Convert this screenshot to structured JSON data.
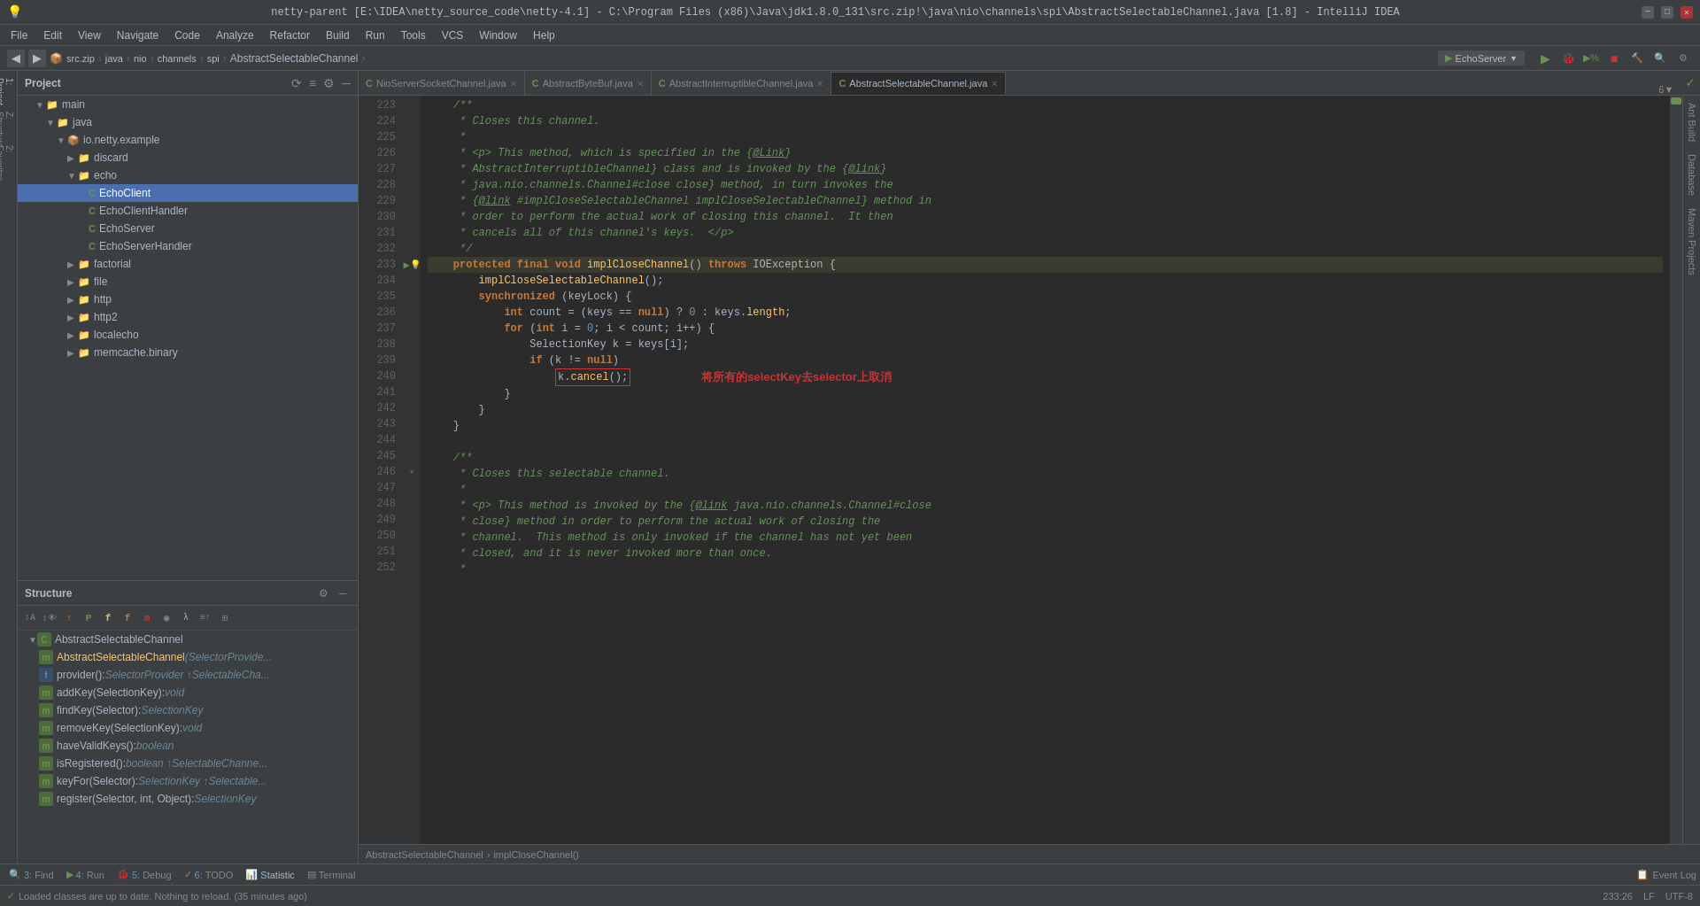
{
  "titlebar": {
    "title": "netty-parent [E:\\IDEA\\netty_source_code\\netty-4.1] - C:\\Program Files (x86)\\Java\\jdk1.8.0_131\\src.zip!\\java\\nio\\channels\\spi\\AbstractSelectableChannel.java [1.8] - IntelliJ IDEA"
  },
  "menubar": {
    "items": [
      "File",
      "Edit",
      "View",
      "Navigate",
      "Code",
      "Analyze",
      "Refactor",
      "Build",
      "Run",
      "Tools",
      "VCS",
      "Window",
      "Help"
    ]
  },
  "breadcrumb": {
    "path": [
      "src.zip",
      "java",
      "nio",
      "channels",
      "spi",
      "AbstractSelectableChannel"
    ],
    "run_config": "EchoServer"
  },
  "project_panel": {
    "title": "Project",
    "tree": [
      {
        "indent": 2,
        "type": "folder",
        "label": "main",
        "expanded": true
      },
      {
        "indent": 3,
        "type": "folder",
        "label": "java",
        "expanded": true
      },
      {
        "indent": 4,
        "type": "folder",
        "label": "io.netty.example",
        "expanded": true
      },
      {
        "indent": 5,
        "type": "folder",
        "label": "discard",
        "expanded": false
      },
      {
        "indent": 5,
        "type": "folder",
        "label": "echo",
        "expanded": true
      },
      {
        "indent": 6,
        "type": "java_c",
        "label": "EchoClient",
        "selected": true
      },
      {
        "indent": 6,
        "type": "java_c",
        "label": "EchoClientHandler"
      },
      {
        "indent": 6,
        "type": "java_c",
        "label": "EchoServer"
      },
      {
        "indent": 6,
        "type": "java_c",
        "label": "EchoServerHandler"
      },
      {
        "indent": 5,
        "type": "folder",
        "label": "factorial",
        "expanded": false
      },
      {
        "indent": 5,
        "type": "folder",
        "label": "file",
        "expanded": false
      },
      {
        "indent": 5,
        "type": "folder",
        "label": "http",
        "expanded": false
      },
      {
        "indent": 5,
        "type": "folder",
        "label": "http2",
        "expanded": false
      },
      {
        "indent": 5,
        "type": "folder",
        "label": "localecho",
        "expanded": false
      },
      {
        "indent": 5,
        "type": "folder",
        "label": "memcache.binary",
        "expanded": false
      }
    ]
  },
  "structure_panel": {
    "title": "Structure",
    "class_name": "AbstractSelectableChannel",
    "items": [
      {
        "type": "constructor",
        "label": "AbstractSelectableChannel(SelectorProvide..."
      },
      {
        "type": "field",
        "label": "provider(): SelectorProvider ↑SelectableCha..."
      },
      {
        "type": "method",
        "label": "addKey(SelectionKey): void"
      },
      {
        "type": "method",
        "label": "findKey(Selector): SelectionKey"
      },
      {
        "type": "method",
        "label": "removeKey(SelectionKey): void"
      },
      {
        "type": "method",
        "label": "haveValidKeys(): boolean"
      },
      {
        "type": "method",
        "label": "isRegistered(): boolean ↑SelectableChanne..."
      },
      {
        "type": "method",
        "label": "keyFor(Selector): SelectionKey ↑Selectable..."
      },
      {
        "type": "method",
        "label": "register(Selector, int, Object): SelectionKey"
      }
    ]
  },
  "tabs": [
    {
      "label": "NioServerSocketChannel.java",
      "type": "C",
      "active": false
    },
    {
      "label": "AbstractByteBuf.java",
      "type": "C",
      "active": false
    },
    {
      "label": "AbstractInterruptibleChannel.java",
      "type": "C",
      "active": false
    },
    {
      "label": "AbstractSelectableChannel.java",
      "type": "C",
      "active": true
    }
  ],
  "tab_count": "6",
  "code": {
    "lines": [
      {
        "num": 223,
        "content": "    /**",
        "type": "comment"
      },
      {
        "num": 224,
        "content": "     * Closes this channel.",
        "type": "comment"
      },
      {
        "num": 225,
        "content": "     *",
        "type": "comment"
      },
      {
        "num": 226,
        "content": "     * <p> This method, which is specified in the {@link",
        "type": "comment"
      },
      {
        "num": 227,
        "content": "     * AbstractInterruptibleChannel} class and is invoked by the {@link",
        "type": "comment"
      },
      {
        "num": 228,
        "content": "     * java.nio.channels.Channel#close close} method, in turn invokes the",
        "type": "comment"
      },
      {
        "num": 229,
        "content": "     * {@link #implCloseSelectableChannel implCloseSelectableChannel} method in",
        "type": "comment"
      },
      {
        "num": 230,
        "content": "     * order to perform the actual work of closing this channel.  It then",
        "type": "comment"
      },
      {
        "num": 231,
        "content": "     * cancels all of this channel's keys.  </p>",
        "type": "comment"
      },
      {
        "num": 232,
        "content": "     */",
        "type": "comment"
      },
      {
        "num": 233,
        "content": "    protected final void implCloseChannel() throws IOException {",
        "type": "code",
        "highlighted": true
      },
      {
        "num": 234,
        "content": "        implCloseSelectableChannel();",
        "type": "code"
      },
      {
        "num": 235,
        "content": "        synchronized (keyLock) {",
        "type": "code"
      },
      {
        "num": 236,
        "content": "            int count = (keys == null) ? 0 : keys.length;",
        "type": "code"
      },
      {
        "num": 237,
        "content": "            for (int i = 0; i < count; i++) {",
        "type": "code"
      },
      {
        "num": 238,
        "content": "                SelectionKey k = keys[i];",
        "type": "code"
      },
      {
        "num": 239,
        "content": "                if (k != null)",
        "type": "code"
      },
      {
        "num": 240,
        "content": "                    k.cancel();",
        "type": "code",
        "has_box": true
      },
      {
        "num": 241,
        "content": "            }",
        "type": "code"
      },
      {
        "num": 242,
        "content": "        }",
        "type": "code"
      },
      {
        "num": 243,
        "content": "    }",
        "type": "code"
      },
      {
        "num": 244,
        "content": "",
        "type": "empty"
      },
      {
        "num": 245,
        "content": "    /**",
        "type": "comment"
      },
      {
        "num": 246,
        "content": "     * Closes this selectable channel.",
        "type": "comment"
      },
      {
        "num": 247,
        "content": "     *",
        "type": "comment"
      },
      {
        "num": 248,
        "content": "     * <p> This method is invoked by the {@link java.nio.channels.Channel#close",
        "type": "comment"
      },
      {
        "num": 249,
        "content": "     * close} method in order to perform the actual work of closing the",
        "type": "comment"
      },
      {
        "num": 250,
        "content": "     * channel.  This method is only invoked if the channel has not yet been",
        "type": "comment"
      },
      {
        "num": 251,
        "content": "     * closed, and it is never invoked more than once.",
        "type": "comment"
      },
      {
        "num": 252,
        "content": "     *",
        "type": "comment"
      }
    ],
    "annotation": "将所有的selectKey去selector上取消"
  },
  "code_breadcrumb": {
    "path": [
      "AbstractSelectableChannel",
      "implCloseChannel()"
    ]
  },
  "bottom_toolbar": {
    "buttons": [
      {
        "num": "3",
        "label": "Find"
      },
      {
        "num": "4",
        "label": "Run"
      },
      {
        "num": "5",
        "label": "Debug"
      },
      {
        "num": "6",
        "label": "TODO"
      },
      {
        "label": "Statistic"
      },
      {
        "label": "Terminal"
      }
    ],
    "event_log": "Event Log"
  },
  "statusbar": {
    "message": "Loaded classes are up to date. Nothing to reload. (35 minutes ago)",
    "position": "233:26",
    "lf": "LF",
    "encoding": "UTF-8"
  },
  "right_labels": [
    "Ant Build",
    "Database",
    "Maven Projects"
  ]
}
